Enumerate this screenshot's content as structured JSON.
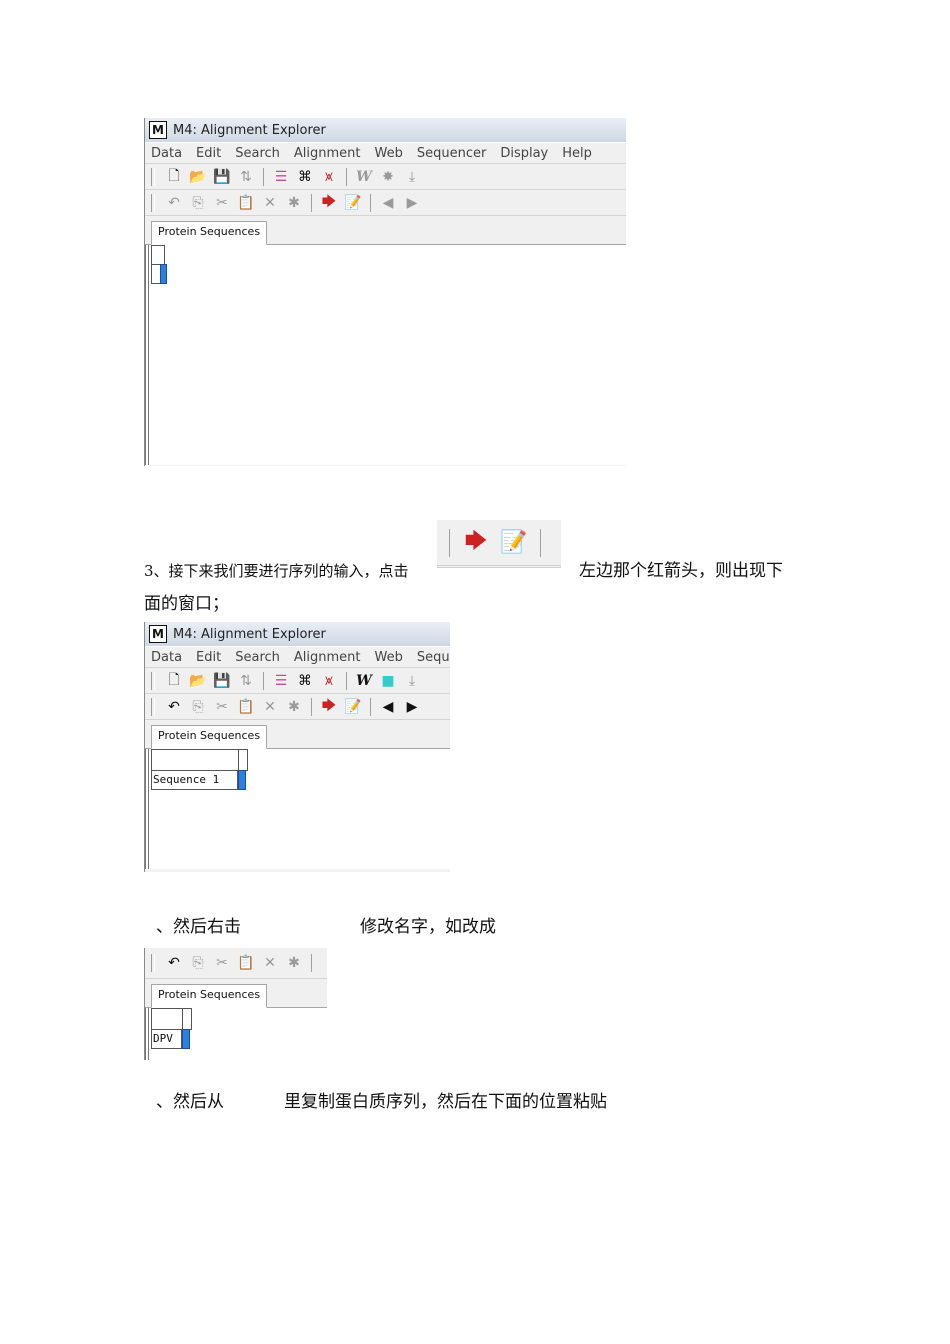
{
  "window": {
    "title": "M4: Alignment Explorer",
    "logo": "M",
    "menus_full": [
      "Data",
      "Edit",
      "Search",
      "Alignment",
      "Web",
      "Sequencer",
      "Display",
      "Help"
    ],
    "menus_cropped": [
      "Data",
      "Edit",
      "Search",
      "Alignment",
      "Web",
      "Seque"
    ],
    "tab_label": "Protein Sequences"
  },
  "sequences": {
    "first": "Sequence 1",
    "renamed": "DPV"
  },
  "text": {
    "step3_left": "3、接下来我们要进行序列的输入，点击",
    "step3_right": "左边那个红箭头，则出现下",
    "step3_cont": "面的窗口；",
    "rename_a": "、然后右击",
    "rename_b": "修改名字，如改成",
    "paste_a": "、然后从",
    "paste_b": "里复制蛋白质序列，然后在下面的位置粘贴"
  },
  "colors": {
    "selection_blue": "#2f7fe0",
    "arrow_red": "#cc2222"
  }
}
